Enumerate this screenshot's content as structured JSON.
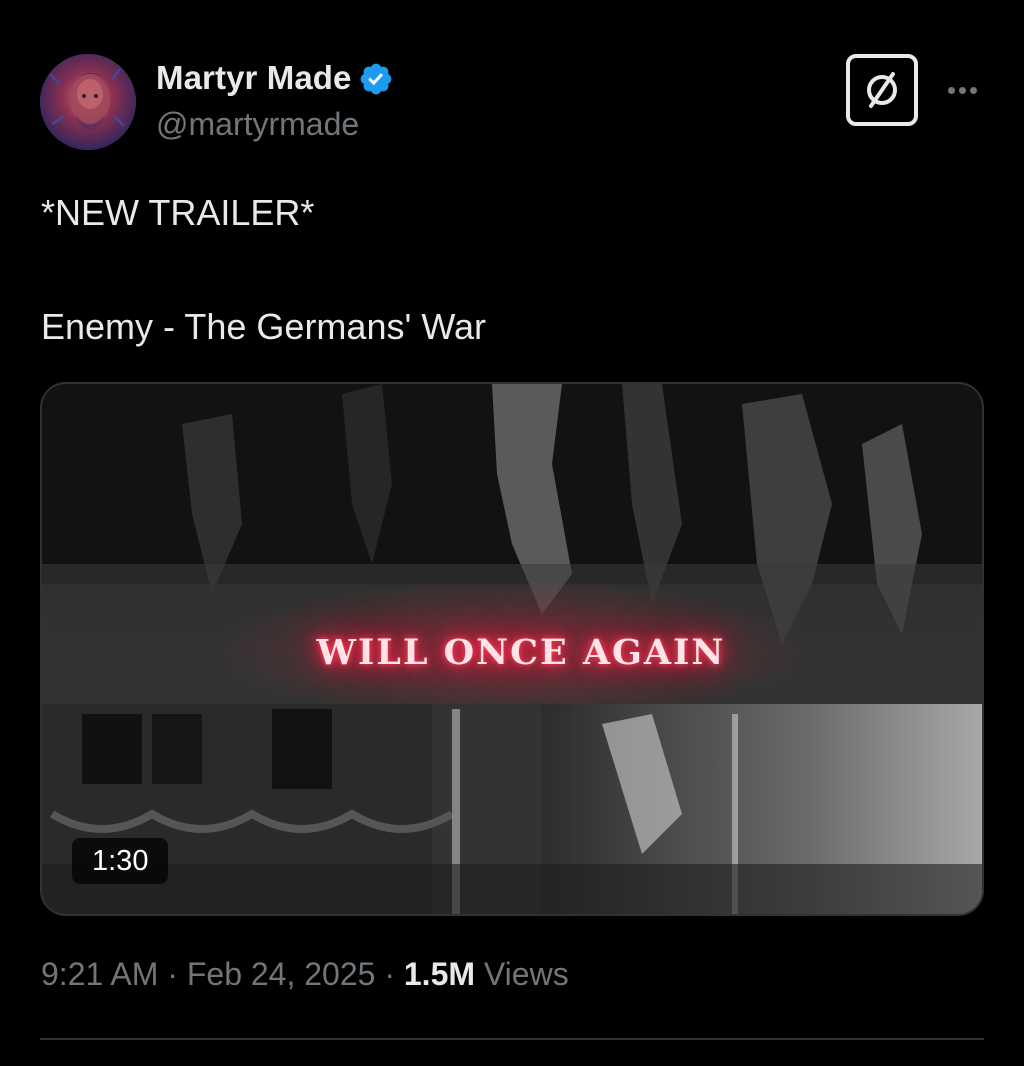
{
  "author": {
    "display_name": "Martyr Made",
    "handle": "@martyrmade",
    "verified": true,
    "verified_color": "#1d9bf0"
  },
  "header_actions": {
    "grok_icon": "grok-slashed-circle-icon",
    "more_icon": "more-horizontal-icon"
  },
  "tweet": {
    "line1": "*NEW TRAILER*",
    "line2": "Enemy - The Germans' War"
  },
  "media": {
    "type": "video",
    "overlay_text": "WILL ONCE AGAIN",
    "overlay_glow_color": "#ff2a4a",
    "duration": "1:30"
  },
  "meta": {
    "time": "9:21 AM",
    "separator": "·",
    "date": "Feb 24, 2025",
    "views_count": "1.5M",
    "views_label": "Views"
  },
  "colors": {
    "background": "#000000",
    "primary_text": "#e7e9ea",
    "secondary_text": "#71767b",
    "border": "#2f3336"
  }
}
